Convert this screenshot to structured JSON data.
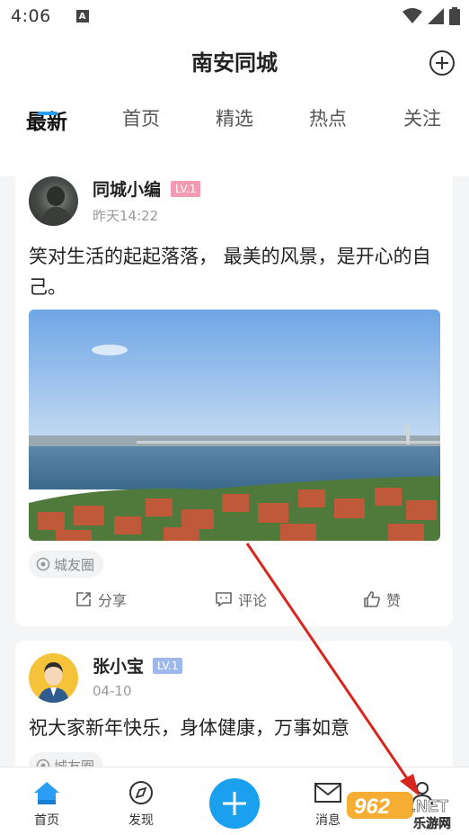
{
  "status_bar": {
    "time": "4:06",
    "notification_icon": "a-letter-icon",
    "icons": [
      "wifi-icon",
      "signal-icon",
      "battery-icon"
    ]
  },
  "header": {
    "title": "南安同城",
    "add_icon": "plus-circle-icon"
  },
  "tabs": [
    {
      "label": "最新",
      "active": true
    },
    {
      "label": "首页",
      "active": false
    },
    {
      "label": "精选",
      "active": false
    },
    {
      "label": "热点",
      "active": false
    },
    {
      "label": "关注",
      "active": false
    }
  ],
  "posts": [
    {
      "username": "同城小编",
      "level": "LV.1",
      "time": "昨天14:22",
      "text": "笑对生活的起起落落， 最美的风景，是开心的自己。",
      "circle_tag": "城友圈",
      "actions": {
        "share": "分享",
        "comment": "评论",
        "like": "赞"
      }
    },
    {
      "username": "张小宝",
      "level": "LV.1",
      "time": "04-10",
      "text": "祝大家新年快乐，身体健康，万事如意",
      "circle_tag": "城友圈"
    }
  ],
  "bottom_nav": [
    {
      "label": "首页",
      "icon": "home-icon",
      "active": true
    },
    {
      "label": "发现",
      "icon": "compass-icon",
      "active": false
    },
    {
      "label": "",
      "icon": "plus-icon",
      "active": false
    },
    {
      "label": "消息",
      "icon": "mail-icon",
      "active": false
    },
    {
      "label": "",
      "icon": "user-icon",
      "active": false
    }
  ],
  "watermark": {
    "text": "962",
    "suffix": ".NET",
    "subtext": "乐游网"
  },
  "colors": {
    "accent": "#1aa0ee",
    "tab_indicator": "#2a9df4",
    "lv_pink": "#f39ab4",
    "lv_blue": "#9fb8ec",
    "arrow": "#d7261e"
  }
}
